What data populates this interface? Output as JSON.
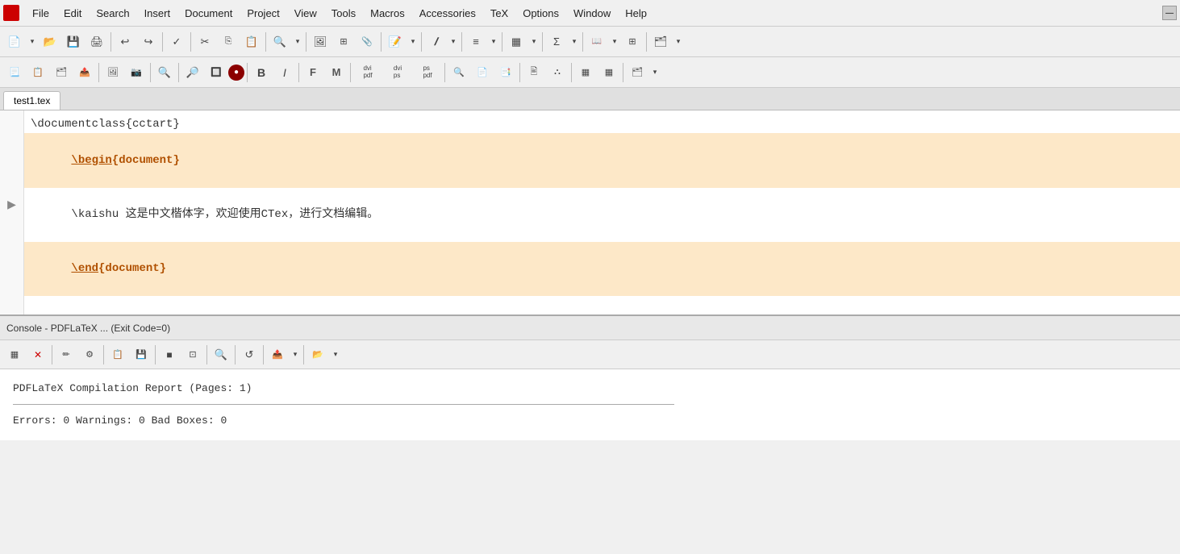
{
  "menubar": {
    "items": [
      {
        "label": "File",
        "id": "file"
      },
      {
        "label": "Edit",
        "id": "edit"
      },
      {
        "label": "Search",
        "id": "search"
      },
      {
        "label": "Insert",
        "id": "insert"
      },
      {
        "label": "Document",
        "id": "document"
      },
      {
        "label": "Project",
        "id": "project"
      },
      {
        "label": "View",
        "id": "view"
      },
      {
        "label": "Tools",
        "id": "tools"
      },
      {
        "label": "Macros",
        "id": "macros"
      },
      {
        "label": "Accessories",
        "id": "accessories"
      },
      {
        "label": "TeX",
        "id": "tex"
      },
      {
        "label": "Options",
        "id": "options"
      },
      {
        "label": "Window",
        "id": "window"
      },
      {
        "label": "Help",
        "id": "help"
      }
    ],
    "window_control": "—"
  },
  "toolbar1": {
    "buttons": [
      {
        "icon": "📄",
        "name": "new"
      },
      {
        "icon": "▾",
        "name": "new-dropdown"
      },
      {
        "icon": "📂",
        "name": "open"
      },
      {
        "icon": "💾",
        "name": "save"
      },
      {
        "icon": "🖨",
        "name": "print"
      },
      {
        "sep": true
      },
      {
        "icon": "↩",
        "name": "undo"
      },
      {
        "icon": "↪",
        "name": "redo"
      },
      {
        "sep": true
      },
      {
        "icon": "✓",
        "name": "spellcheck"
      },
      {
        "sep": true
      },
      {
        "icon": "✂",
        "name": "cut"
      },
      {
        "icon": "📋",
        "name": "copy"
      },
      {
        "icon": "📌",
        "name": "paste"
      },
      {
        "sep": true
      },
      {
        "icon": "🔍",
        "name": "find"
      },
      {
        "icon": "▾",
        "name": "find-dropdown"
      },
      {
        "sep": true
      },
      {
        "icon": "🖼",
        "name": "insert-image"
      },
      {
        "icon": "▦",
        "name": "insert-table"
      },
      {
        "icon": "📎",
        "name": "insert-misc"
      },
      {
        "sep": true
      },
      {
        "icon": "📝",
        "name": "format"
      },
      {
        "icon": "▾",
        "name": "format-dropdown"
      },
      {
        "sep": true
      },
      {
        "icon": "𝐼",
        "name": "italic"
      },
      {
        "icon": "▾",
        "name": "italic-dropdown"
      },
      {
        "sep": true
      },
      {
        "icon": "≡",
        "name": "list"
      },
      {
        "icon": "▾",
        "name": "list-dropdown"
      },
      {
        "sep": true
      },
      {
        "icon": "▦",
        "name": "table2"
      },
      {
        "icon": "▾",
        "name": "table2-dropdown"
      },
      {
        "sep": true
      },
      {
        "icon": "Σ",
        "name": "math"
      },
      {
        "icon": "▾",
        "name": "math-dropdown"
      },
      {
        "sep": true
      },
      {
        "icon": "📖",
        "name": "ref"
      },
      {
        "icon": "▾",
        "name": "ref-dropdown"
      },
      {
        "icon": "⊞",
        "name": "ref2"
      },
      {
        "sep": true
      },
      {
        "icon": "🗂",
        "name": "misc"
      },
      {
        "icon": "▾",
        "name": "misc-dropdown"
      }
    ]
  },
  "toolbar2": {
    "buttons": [
      {
        "icon": "📃",
        "name": "new2"
      },
      {
        "icon": "📋",
        "name": "copy2"
      },
      {
        "icon": "🗂",
        "name": "proj"
      },
      {
        "icon": "📤",
        "name": "export"
      },
      {
        "sep": true
      },
      {
        "icon": "🖼",
        "name": "img2"
      },
      {
        "icon": "📷",
        "name": "imgcap"
      },
      {
        "sep": true
      },
      {
        "icon": "🔍",
        "name": "search2"
      },
      {
        "sep": true
      },
      {
        "icon": "🔎",
        "name": "search3"
      },
      {
        "icon": "🔲",
        "name": "box"
      },
      {
        "icon": "🔴",
        "name": "rec"
      },
      {
        "sep": true
      },
      {
        "icon": "B",
        "name": "bold-b"
      },
      {
        "icon": "𝐼",
        "name": "italic-i"
      },
      {
        "sep": true
      },
      {
        "icon": "F",
        "name": "font-f"
      },
      {
        "icon": "M",
        "name": "font-m"
      },
      {
        "sep": true
      },
      {
        "icon": "dvi/pdf",
        "name": "dvi-pdf"
      },
      {
        "icon": "dvi/ps",
        "name": "dvi-ps"
      },
      {
        "icon": "ps/pdf",
        "name": "ps-pdf"
      },
      {
        "sep": true
      },
      {
        "icon": "🔍",
        "name": "dvi-view"
      },
      {
        "icon": "📄",
        "name": "ps-view"
      },
      {
        "icon": "📑",
        "name": "pdf-view"
      },
      {
        "sep": true
      },
      {
        "icon": "🖹",
        "name": "log"
      },
      {
        "icon": "⛬",
        "name": "misc2"
      },
      {
        "sep": true
      },
      {
        "icon": "▦",
        "name": "layout"
      },
      {
        "icon": "▦",
        "name": "layout2"
      },
      {
        "sep": true
      },
      {
        "icon": "🗂",
        "name": "misc3"
      },
      {
        "icon": "▾",
        "name": "misc3-dropdown"
      }
    ]
  },
  "tab": {
    "label": "test1.tex"
  },
  "editor": {
    "lines": [
      {
        "text": "\\documentclass{cctart}",
        "highlight": false,
        "type": "normal"
      },
      {
        "text": "\\begin{document}",
        "highlight": true,
        "type": "bold"
      },
      {
        "text": "\\kaishu 这是中文楷体字，欢迎使用CTex，进行文档编辑。",
        "highlight": false,
        "type": "mixed"
      },
      {
        "text": "\\end{document}",
        "highlight": true,
        "type": "bold"
      }
    ]
  },
  "console": {
    "title": "Console - PDFLaTeX ... (Exit Code=0)",
    "report_line": "PDFLaTeX Compilation Report (Pages: 1)",
    "errors_line": "Errors: 0    Warnings: 0    Bad Boxes: 0"
  },
  "console_toolbar": {
    "buttons": [
      {
        "icon": "▦",
        "name": "c-screen"
      },
      {
        "icon": "✕",
        "name": "c-stop"
      },
      {
        "sep": true
      },
      {
        "icon": "✏",
        "name": "c-edit"
      },
      {
        "icon": "⚙",
        "name": "c-settings"
      },
      {
        "sep": true
      },
      {
        "icon": "📋",
        "name": "c-copy"
      },
      {
        "icon": "💾",
        "name": "c-save"
      },
      {
        "sep": true
      },
      {
        "icon": "■",
        "name": "c-stop2"
      },
      {
        "icon": "⊡",
        "name": "c-frame"
      },
      {
        "sep": true
      },
      {
        "icon": "🔍",
        "name": "c-search"
      },
      {
        "sep": true
      },
      {
        "icon": "↺",
        "name": "c-refresh"
      },
      {
        "sep": true
      },
      {
        "icon": "📤",
        "name": "c-export"
      },
      {
        "icon": "▾",
        "name": "c-export-dd"
      },
      {
        "sep": true
      },
      {
        "icon": "📂",
        "name": "c-open"
      },
      {
        "icon": "▾",
        "name": "c-open-dd"
      }
    ]
  }
}
